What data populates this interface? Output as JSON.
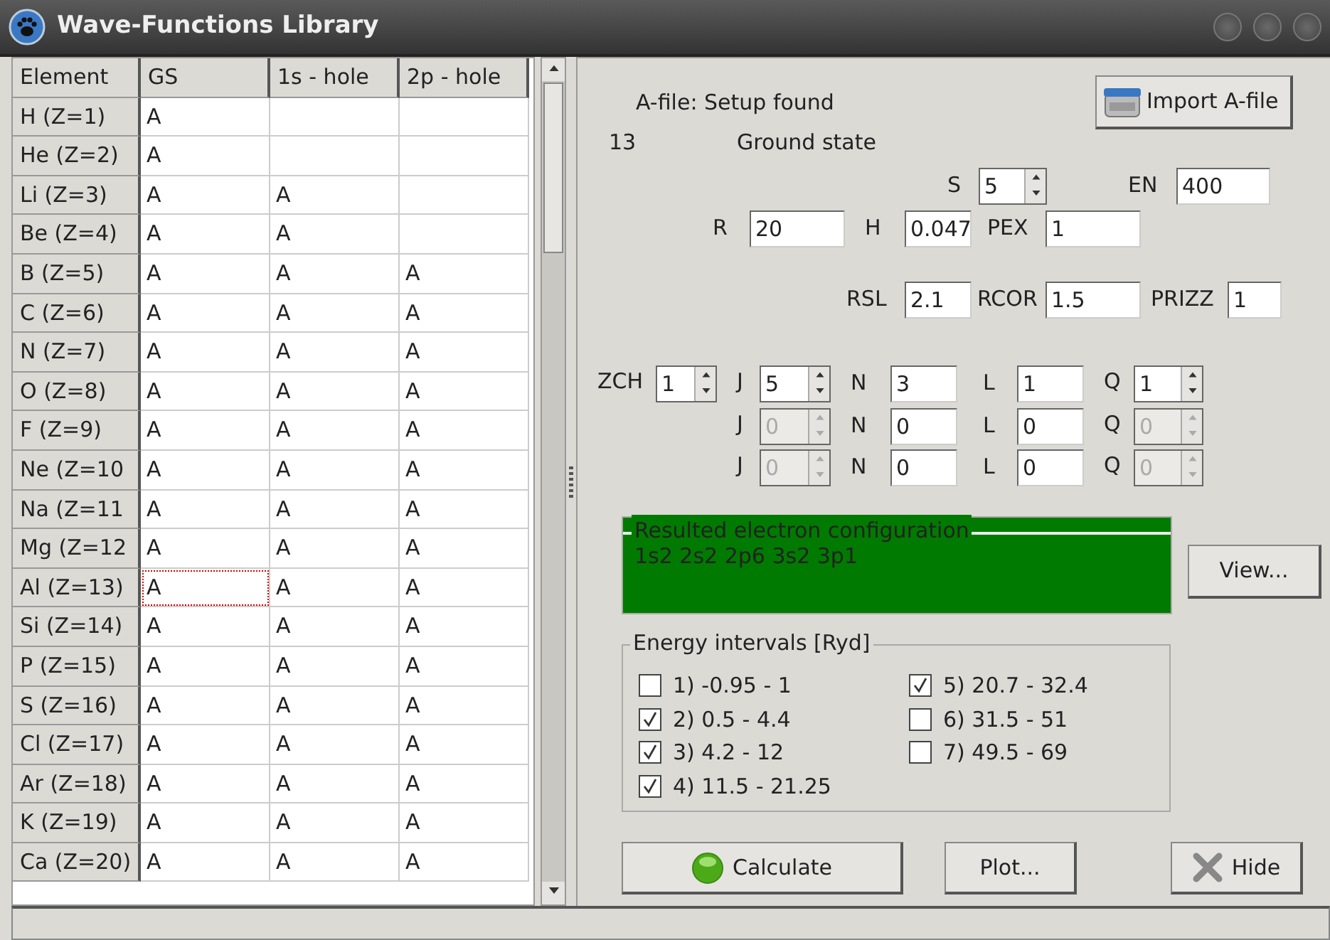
{
  "window": {
    "title": "Wave-Functions Library"
  },
  "table": {
    "columns": [
      "Element",
      "GS",
      "1s - hole",
      "2p - hole"
    ],
    "rows": [
      {
        "cells": [
          {
            "text": "H (Z=1)",
            "kind": "header"
          },
          {
            "text": "A",
            "focused": false
          },
          {
            "text": "",
            "focused": false
          },
          {
            "text": "",
            "focused": false
          }
        ]
      },
      {
        "cells": [
          {
            "text": "He (Z=2)",
            "kind": "header"
          },
          {
            "text": "A",
            "focused": false
          },
          {
            "text": "",
            "focused": false
          },
          {
            "text": "",
            "focused": false
          }
        ]
      },
      {
        "cells": [
          {
            "text": "Li (Z=3)",
            "kind": "header"
          },
          {
            "text": "A",
            "focused": false
          },
          {
            "text": "A",
            "focused": false
          },
          {
            "text": "",
            "focused": false
          }
        ]
      },
      {
        "cells": [
          {
            "text": "Be (Z=4)",
            "kind": "header"
          },
          {
            "text": "A",
            "focused": false
          },
          {
            "text": "A",
            "focused": false
          },
          {
            "text": "",
            "focused": false
          }
        ]
      },
      {
        "cells": [
          {
            "text": "B (Z=5)",
            "kind": "header"
          },
          {
            "text": "A",
            "focused": false
          },
          {
            "text": "A",
            "focused": false
          },
          {
            "text": "A",
            "focused": false
          }
        ]
      },
      {
        "cells": [
          {
            "text": "C (Z=6)",
            "kind": "header"
          },
          {
            "text": "A",
            "focused": false
          },
          {
            "text": "A",
            "focused": false
          },
          {
            "text": "A",
            "focused": false
          }
        ]
      },
      {
        "cells": [
          {
            "text": "N (Z=7)",
            "kind": "header"
          },
          {
            "text": "A",
            "focused": false
          },
          {
            "text": "A",
            "focused": false
          },
          {
            "text": "A",
            "focused": false
          }
        ]
      },
      {
        "cells": [
          {
            "text": "O (Z=8)",
            "kind": "header"
          },
          {
            "text": "A",
            "focused": false
          },
          {
            "text": "A",
            "focused": false
          },
          {
            "text": "A",
            "focused": false
          }
        ]
      },
      {
        "cells": [
          {
            "text": "F (Z=9)",
            "kind": "header"
          },
          {
            "text": "A",
            "focused": false
          },
          {
            "text": "A",
            "focused": false
          },
          {
            "text": "A",
            "focused": false
          }
        ]
      },
      {
        "cells": [
          {
            "text": "Ne (Z=10",
            "kind": "header"
          },
          {
            "text": "A",
            "focused": false
          },
          {
            "text": "A",
            "focused": false
          },
          {
            "text": "A",
            "focused": false
          }
        ]
      },
      {
        "cells": [
          {
            "text": "Na (Z=11",
            "kind": "header"
          },
          {
            "text": "A",
            "focused": false
          },
          {
            "text": "A",
            "focused": false
          },
          {
            "text": "A",
            "focused": false
          }
        ]
      },
      {
        "cells": [
          {
            "text": "Mg (Z=12",
            "kind": "header"
          },
          {
            "text": "A",
            "focused": false
          },
          {
            "text": "A",
            "focused": false
          },
          {
            "text": "A",
            "focused": false
          }
        ]
      },
      {
        "cells": [
          {
            "text": "Al (Z=13)",
            "kind": "header"
          },
          {
            "text": "A",
            "focused": true
          },
          {
            "text": "A",
            "focused": false
          },
          {
            "text": "A",
            "focused": false
          }
        ]
      },
      {
        "cells": [
          {
            "text": "Si (Z=14)",
            "kind": "header"
          },
          {
            "text": "A",
            "focused": false
          },
          {
            "text": "A",
            "focused": false
          },
          {
            "text": "A",
            "focused": false
          }
        ]
      },
      {
        "cells": [
          {
            "text": "P (Z=15)",
            "kind": "header"
          },
          {
            "text": "A",
            "focused": false
          },
          {
            "text": "A",
            "focused": false
          },
          {
            "text": "A",
            "focused": false
          }
        ]
      },
      {
        "cells": [
          {
            "text": "S (Z=16)",
            "kind": "header"
          },
          {
            "text": "A",
            "focused": false
          },
          {
            "text": "A",
            "focused": false
          },
          {
            "text": "A",
            "focused": false
          }
        ]
      },
      {
        "cells": [
          {
            "text": "Cl (Z=17)",
            "kind": "header"
          },
          {
            "text": "A",
            "focused": false
          },
          {
            "text": "A",
            "focused": false
          },
          {
            "text": "A",
            "focused": false
          }
        ]
      },
      {
        "cells": [
          {
            "text": "Ar (Z=18)",
            "kind": "header"
          },
          {
            "text": "A",
            "focused": false
          },
          {
            "text": "A",
            "focused": false
          },
          {
            "text": "A",
            "focused": false
          }
        ]
      },
      {
        "cells": [
          {
            "text": "K (Z=19)",
            "kind": "header"
          },
          {
            "text": "A",
            "focused": false
          },
          {
            "text": "A",
            "focused": false
          },
          {
            "text": "A",
            "focused": false
          }
        ]
      },
      {
        "cells": [
          {
            "text": "Ca (Z=20)",
            "kind": "header"
          },
          {
            "text": "A",
            "focused": false
          },
          {
            "text": "A",
            "focused": false
          },
          {
            "text": "A",
            "focused": false
          }
        ]
      }
    ]
  },
  "setup": {
    "status": "A-file: Setup found",
    "import_button": "Import A-file",
    "number": "13",
    "state": "Ground state"
  },
  "param_rows": [
    {
      "params": [
        {
          "label": "S",
          "kind": "spinner",
          "value": "5",
          "disabled": false
        },
        {
          "label": "EN",
          "kind": "field",
          "value": "400"
        }
      ]
    },
    {
      "params": [
        {
          "label": "R",
          "kind": "field",
          "value": "20"
        },
        {
          "label": "H",
          "kind": "field",
          "value": "0.047"
        },
        {
          "label": "PEX",
          "kind": "field",
          "value": "1"
        }
      ]
    },
    {
      "params": [
        {
          "label": "RSL",
          "kind": "field",
          "value": "2.1"
        },
        {
          "label": "RCOR",
          "kind": "field",
          "value": "1.5"
        },
        {
          "label": "PRIZZ",
          "kind": "field",
          "value": "1"
        }
      ]
    },
    {
      "params": [
        {
          "label": "ZCH",
          "kind": "spinner",
          "value": "1",
          "disabled": false
        },
        {
          "label": "J",
          "kind": "spinner",
          "value": "5",
          "disabled": false
        },
        {
          "label": "N",
          "kind": "field",
          "value": "3"
        },
        {
          "label": "L",
          "kind": "field",
          "value": "1"
        },
        {
          "label": "Q",
          "kind": "spinner",
          "value": "1",
          "disabled": false
        }
      ]
    },
    {
      "params": [
        {
          "label": "J",
          "kind": "spinner",
          "value": "0",
          "disabled": true
        },
        {
          "label": "N",
          "kind": "field",
          "value": "0"
        },
        {
          "label": "L",
          "kind": "field",
          "value": "0"
        },
        {
          "label": "Q",
          "kind": "spinner",
          "value": "0",
          "disabled": true
        }
      ]
    },
    {
      "params": [
        {
          "label": "J",
          "kind": "spinner",
          "value": "0",
          "disabled": true
        },
        {
          "label": "N",
          "kind": "field",
          "value": "0"
        },
        {
          "label": "L",
          "kind": "field",
          "value": "0"
        },
        {
          "label": "Q",
          "kind": "spinner",
          "value": "0",
          "disabled": true
        }
      ]
    }
  ],
  "configuration": {
    "title": "Resulted electron configuration",
    "value": "1s2 2s2 2p6 3s2 3p1"
  },
  "view_button": "View...",
  "energy_intervals": {
    "title": "Energy intervals [Ryd]",
    "items": [
      {
        "label": "1) -0.95 - 1",
        "checked": false
      },
      {
        "label": "2) 0.5 - 4.4",
        "checked": true
      },
      {
        "label": "3) 4.2 - 12",
        "checked": true
      },
      {
        "label": "4) 11.5 - 21.25",
        "checked": true
      },
      {
        "label": "5) 20.7 - 32.4",
        "checked": true
      },
      {
        "label": "6) 31.5 - 51",
        "checked": false
      },
      {
        "label": "7) 49.5 - 69",
        "checked": false
      }
    ]
  },
  "buttons": [
    {
      "label": "Calculate",
      "kind": "calculate"
    },
    {
      "label": "Plot...",
      "kind": "plot"
    },
    {
      "label": "Hide",
      "kind": "hide"
    }
  ]
}
